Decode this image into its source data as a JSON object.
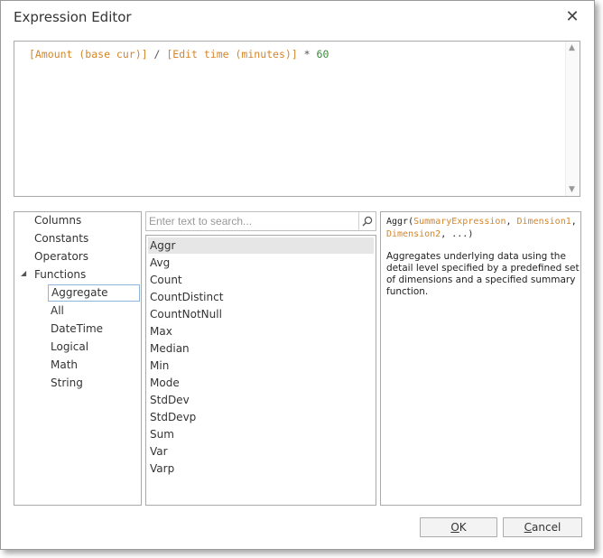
{
  "dialog": {
    "title": "Expression Editor",
    "close_glyph": "✕"
  },
  "expression": {
    "col1": "[Amount (base cur)]",
    "op1": " / ",
    "col2": "[Edit time (minutes)]",
    "op2": " * ",
    "num": "60"
  },
  "categories": {
    "items": [
      {
        "label": "Columns"
      },
      {
        "label": "Constants"
      },
      {
        "label": "Operators"
      },
      {
        "label": "Functions"
      }
    ],
    "functions_expander": "◢",
    "subitems": [
      {
        "label": "Aggregate",
        "selected": true
      },
      {
        "label": "All"
      },
      {
        "label": "DateTime"
      },
      {
        "label": "Logical"
      },
      {
        "label": "Math"
      },
      {
        "label": "String"
      }
    ]
  },
  "search": {
    "placeholder": "Enter text to search...",
    "value": "",
    "icon": "search-icon"
  },
  "functions": {
    "items": [
      "Aggr",
      "Avg",
      "Count",
      "CountDistinct",
      "CountNotNull",
      "Max",
      "Median",
      "Min",
      "Mode",
      "StdDev",
      "StdDevp",
      "Sum",
      "Var",
      "Varp"
    ],
    "selected_index": 0
  },
  "description": {
    "sig_name": "Aggr",
    "sig_open": "(",
    "arg1": "SummaryExpression",
    "sep1": ", ",
    "arg2": "Dimension1",
    "sep2": ",",
    "arg3": "Dimension2",
    "tail": ", ...)",
    "text": "Aggregates underlying data using the detail level specified by a predefined set of dimensions and a specified summary function."
  },
  "buttons": {
    "ok_mnemonic": "O",
    "ok_rest": "K",
    "cancel_mnemonic": "C",
    "cancel_rest": "ancel"
  },
  "colors": {
    "column_ref": "#d4862a",
    "number": "#3a8a3a",
    "operator": "#555555",
    "selection": "#e6e6e6",
    "sub_selected_border": "#8fb4d9"
  }
}
